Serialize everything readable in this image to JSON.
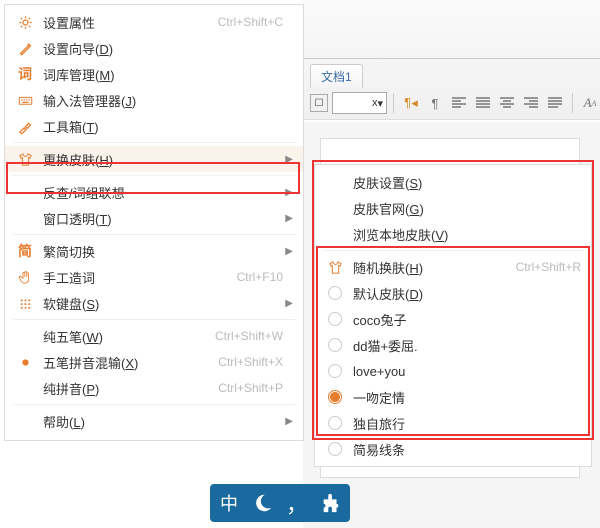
{
  "colors": {
    "accent": "#e77c2d",
    "highlight": "#e33",
    "imebar": "#1a6aa0"
  },
  "menu": {
    "items": [
      {
        "icon": "sun",
        "label": "设置属性",
        "accel": "Ctrl+Shift+C"
      },
      {
        "icon": "wizard",
        "label": "设置向导(D)",
        "accel": ""
      },
      {
        "icon": "ci",
        "label": "词库管理(M)",
        "accel": ""
      },
      {
        "icon": "keyboard",
        "label": "输入法管理器(J)",
        "accel": ""
      },
      {
        "icon": "hammer",
        "label": "工具箱(T)",
        "accel": ""
      },
      {
        "sep": true
      },
      {
        "icon": "shirt",
        "label": "更换皮肤(H)",
        "accel": "",
        "sub": true,
        "hl": true
      },
      {
        "sep": true
      },
      {
        "icon": "",
        "label": "反查/词组联想",
        "accel": "",
        "sub": true
      },
      {
        "icon": "",
        "label": "窗口透明(T)",
        "accel": "",
        "sub": true
      },
      {
        "sep": true
      },
      {
        "icon": "jian",
        "label": "繁简切换",
        "accel": "",
        "sub": true
      },
      {
        "icon": "hand",
        "label": "手工造词",
        "accel": "Ctrl+F10"
      },
      {
        "icon": "dots",
        "label": "软键盘(S)",
        "accel": "",
        "sub": true
      },
      {
        "sep": true
      },
      {
        "icon": "",
        "label": "纯五笔(W)",
        "accel": "Ctrl+Shift+W"
      },
      {
        "icon": "dot",
        "label": "五笔拼音混输(X)",
        "accel": "Ctrl+Shift+X"
      },
      {
        "icon": "",
        "label": "纯拼音(P)",
        "accel": "Ctrl+Shift+P"
      },
      {
        "sep": true
      },
      {
        "icon": "",
        "label": "帮助(L)",
        "accel": "",
        "sub": true
      }
    ]
  },
  "submenu": {
    "top": [
      {
        "label": "皮肤设置(S)"
      },
      {
        "label": "皮肤官网(G)"
      },
      {
        "label": "浏览本地皮肤(V)"
      }
    ],
    "skins": [
      {
        "icon": "shirt",
        "label": "随机换肤(H)",
        "accel": "Ctrl+Shift+R"
      },
      {
        "label": "默认皮肤(D)"
      },
      {
        "label": "coco兔子"
      },
      {
        "label": "dd猫+委屈."
      },
      {
        "label": "love+you"
      },
      {
        "label": "一吻定情",
        "selected": true
      },
      {
        "label": "独自旅行"
      },
      {
        "label": "简易线条"
      }
    ]
  },
  "toolbar": {
    "tab_label": "文档1",
    "dropdown_suffix": "x",
    "icons": [
      "pilcrow",
      "para",
      "align-left",
      "align-dist",
      "align-center",
      "align-right",
      "align-just",
      "font"
    ]
  },
  "ime": {
    "cells": [
      "中",
      "moon",
      "comma",
      "puzzle"
    ]
  }
}
